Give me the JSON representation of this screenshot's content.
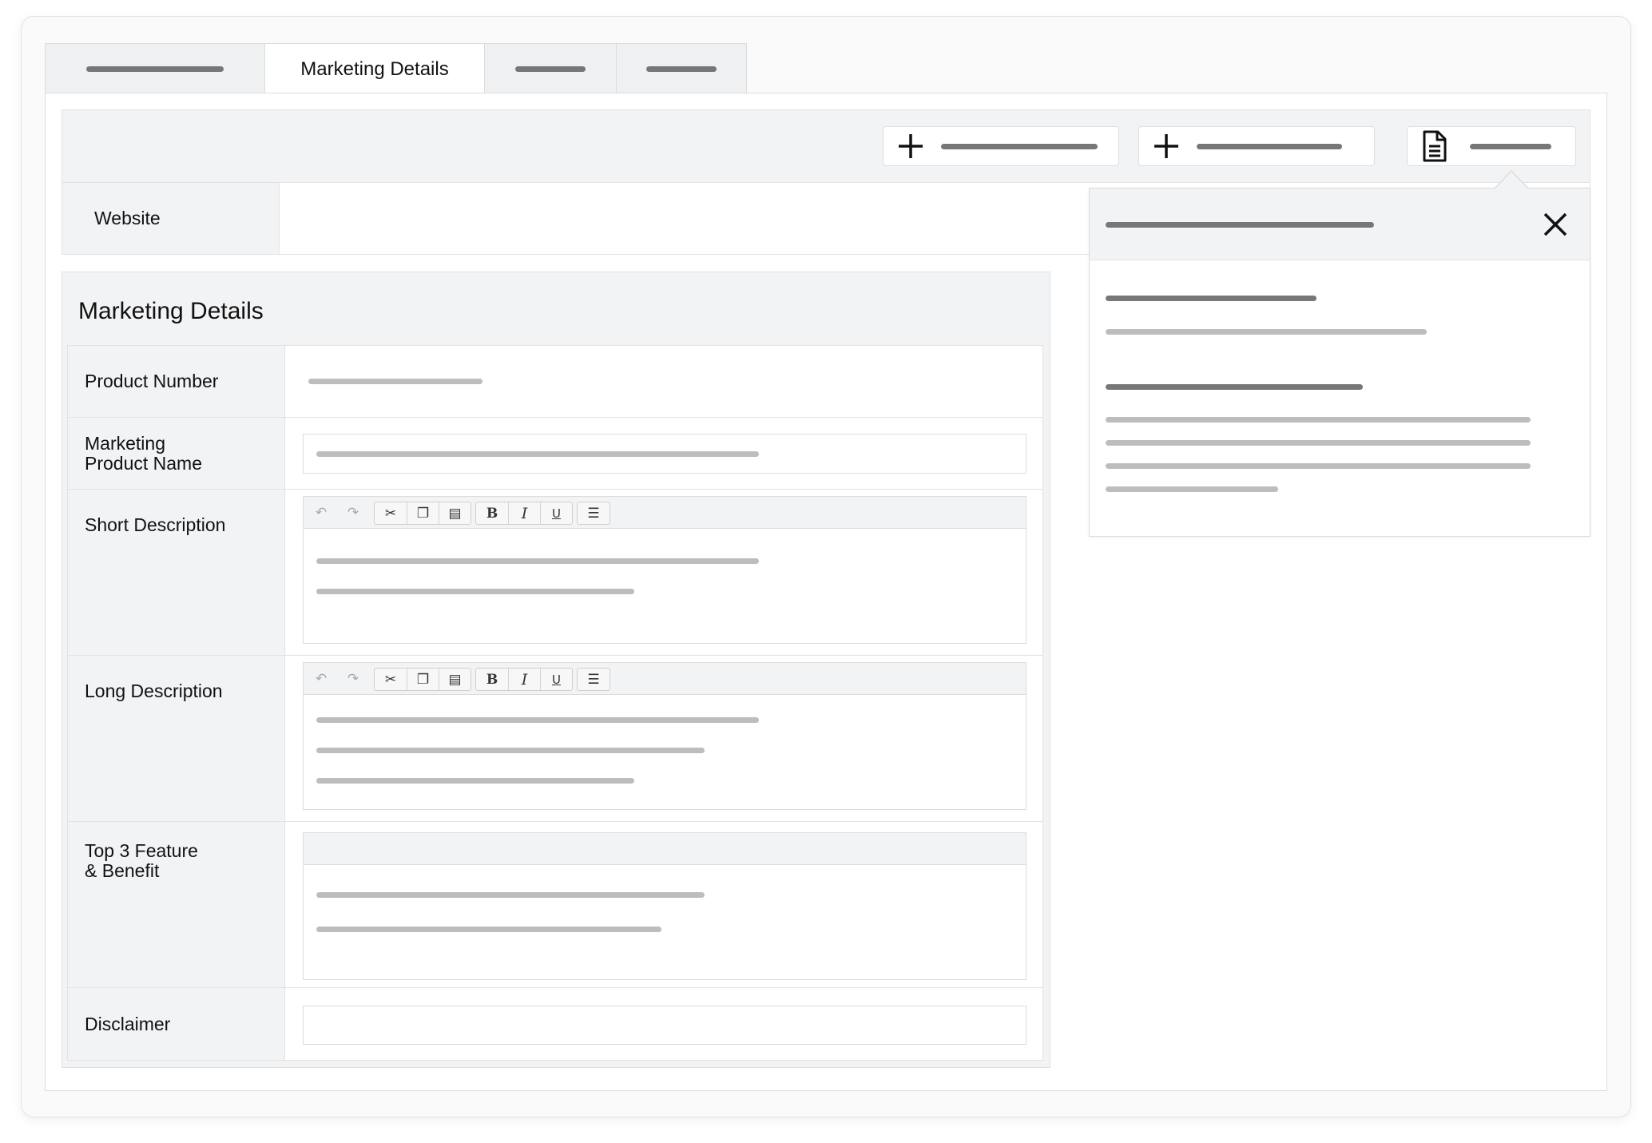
{
  "tabs": {
    "active_label": "Marketing Details"
  },
  "website": {
    "label": "Website"
  },
  "section": {
    "title": "Marketing Details"
  },
  "fields": {
    "product_number": "Product Number",
    "marketing_product_name_line1": "Marketing",
    "marketing_product_name_line2": "Product Name",
    "short_description": "Short Description",
    "long_description": "Long Description",
    "top3_line1": "Top 3 Feature",
    "top3_line2": "& Benefit",
    "disclaimer": "Disclaimer"
  },
  "editor_toolbar": {
    "bold": "B",
    "italic": "I",
    "underline": "U"
  },
  "icons": {
    "add": "plus-icon",
    "document": "document-icon",
    "close": "close-icon",
    "undo": "undo-icon",
    "redo": "redo-icon",
    "cut": "scissors-icon",
    "copy": "copy-icon",
    "paste": "paste-icon",
    "list": "bullet-list-icon"
  },
  "colors": {
    "placeholder_dark": "#777777",
    "placeholder_light": "#bdbdbd",
    "panel_gray": "#f2f3f5"
  }
}
